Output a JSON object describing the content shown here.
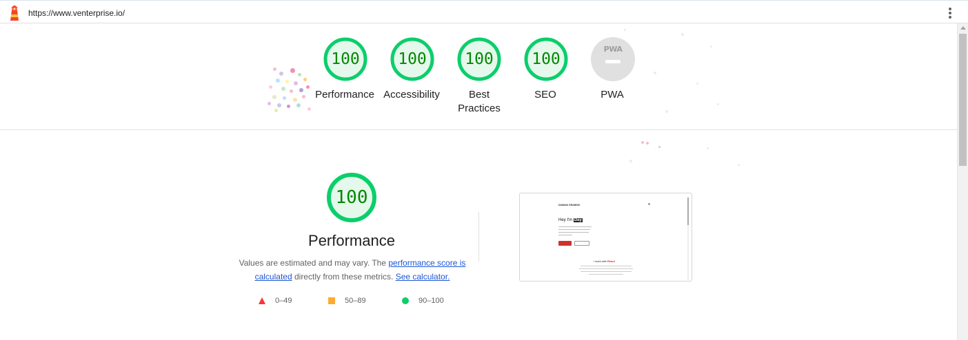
{
  "topbar": {
    "url": "https://www.venterprise.io/",
    "logo": "lighthouse-icon",
    "menu_icon": "more-vert-icon"
  },
  "categories": [
    {
      "id": "performance",
      "score": "100",
      "label": "Performance"
    },
    {
      "id": "accessibility",
      "score": "100",
      "label": "Accessibility"
    },
    {
      "id": "best-practices",
      "score": "100",
      "label": "Best Practices"
    },
    {
      "id": "seo",
      "score": "100",
      "label": "SEO"
    },
    {
      "id": "pwa",
      "score": "",
      "label": "PWA",
      "badge_text": "PWA"
    }
  ],
  "performance": {
    "score": "100",
    "title": "Performance",
    "desc_prefix": "Values are estimated and may vary. The ",
    "link1": "performance score is calculated",
    "desc_middle": " directly from these metrics. ",
    "link2": "See calculator."
  },
  "legend": [
    {
      "icon": "fail-triangle-icon",
      "range": "0–49",
      "color": "#ff3333"
    },
    {
      "icon": "average-square-icon",
      "range": "50–89",
      "color": "#ffaa33"
    },
    {
      "icon": "pass-circle-icon",
      "range": "90–100",
      "color": "#0cce6b"
    }
  ],
  "thumbnail": {
    "brand": "DAMIAN GRABSKI",
    "heading_prefix": "Hey I'm ",
    "heading_name": "Day",
    "subheading_prefix": "I work with ",
    "subheading_highlight": "React"
  },
  "colors": {
    "pass": "#0cce6b",
    "pass_text": "#008800",
    "pass_fill": "#e5f8ec",
    "na": "#e0e0e0",
    "link": "#1a56d6"
  }
}
